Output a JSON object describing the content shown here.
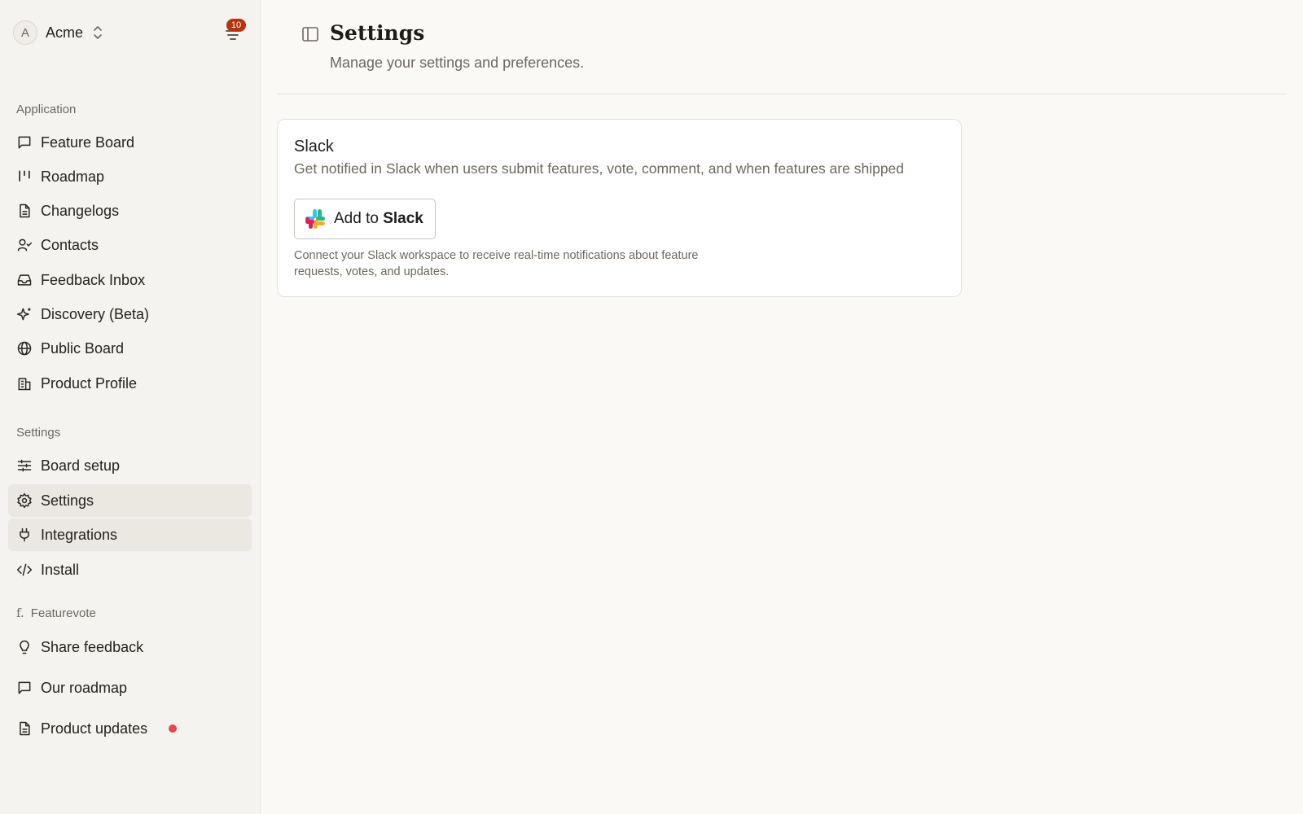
{
  "workspace": {
    "avatar_letter": "A",
    "name": "Acme"
  },
  "notifications": {
    "count": "10"
  },
  "sidebar": {
    "application_label": "Application",
    "application_items": [
      {
        "label": "Feature Board",
        "icon": "message-square-icon"
      },
      {
        "label": "Roadmap",
        "icon": "roadmap-columns-icon"
      },
      {
        "label": "Changelogs",
        "icon": "file-text-icon"
      },
      {
        "label": "Contacts",
        "icon": "user-check-icon"
      },
      {
        "label": "Feedback Inbox",
        "icon": "inbox-icon"
      },
      {
        "label": "Discovery (Beta)",
        "icon": "sparkles-icon"
      },
      {
        "label": "Public Board",
        "icon": "globe-icon"
      },
      {
        "label": "Product Profile",
        "icon": "building-icon"
      }
    ],
    "settings_label": "Settings",
    "settings_items": [
      {
        "label": "Board setup",
        "icon": "sliders-icon"
      },
      {
        "label": "Settings",
        "icon": "gear-icon",
        "active": true
      },
      {
        "label": "Integrations",
        "icon": "plug-icon",
        "active": true
      },
      {
        "label": "Install",
        "icon": "code-icon"
      }
    ],
    "featurevote_label": "Featurevote",
    "featurevote_logo": "f.",
    "featurevote_items": [
      {
        "label": "Share feedback",
        "icon": "lightbulb-icon"
      },
      {
        "label": "Our roadmap",
        "icon": "message-square-icon"
      },
      {
        "label": "Product updates",
        "icon": "file-text-icon",
        "unread": true
      }
    ]
  },
  "page": {
    "title": "Settings",
    "subtitle": "Manage your settings and preferences."
  },
  "slack_card": {
    "title": "Slack",
    "description": "Get notified in Slack when users submit features, vote, comment, and when features are shipped",
    "button_prefix": "Add to ",
    "button_brand": "Slack",
    "note": "Connect your Slack workspace to receive real-time notifications about feature requests, votes, and updates."
  },
  "colors": {
    "sidebar_bg": "#f5f3ef",
    "main_bg": "#faf9f6",
    "active_bg": "#ebe8e2",
    "badge": "#b8320f",
    "unread_dot": "#e5484d"
  }
}
